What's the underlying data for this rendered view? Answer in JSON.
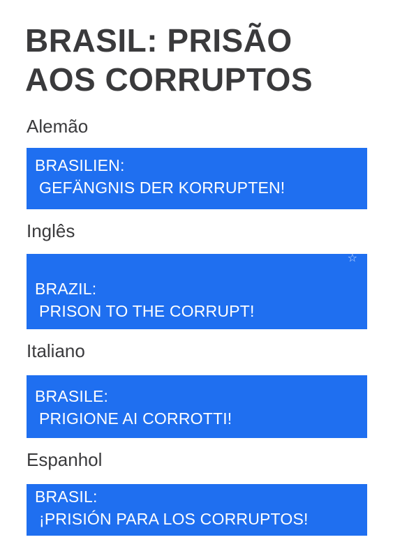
{
  "title": {
    "line1": "BRASIL: PRISÃO",
    "line2": "AOS CORRUPTOS"
  },
  "translations": [
    {
      "language": "Alemão",
      "line1": "BRASILIEN:",
      "line2": "GEFÄNGNIS DER KORRUPTEN!"
    },
    {
      "language": "Inglês",
      "line1": "BRAZIL:",
      "line2": "PRISON TO THE CORRUPT!"
    },
    {
      "language": "Italiano",
      "line1": "BRASILE:",
      "line2": "PRIGIONE AI CORROTTI!"
    },
    {
      "language": "Espanhol",
      "line1": "BRASIL:",
      "line2": "¡PRISIÓN PARA LOS CORRUPTOS!"
    }
  ],
  "colors": {
    "card_background": "#1f6ff0",
    "card_text": "#ffffff",
    "heading_text": "#3a3a3c"
  },
  "icons": {
    "star": "star-icon"
  }
}
